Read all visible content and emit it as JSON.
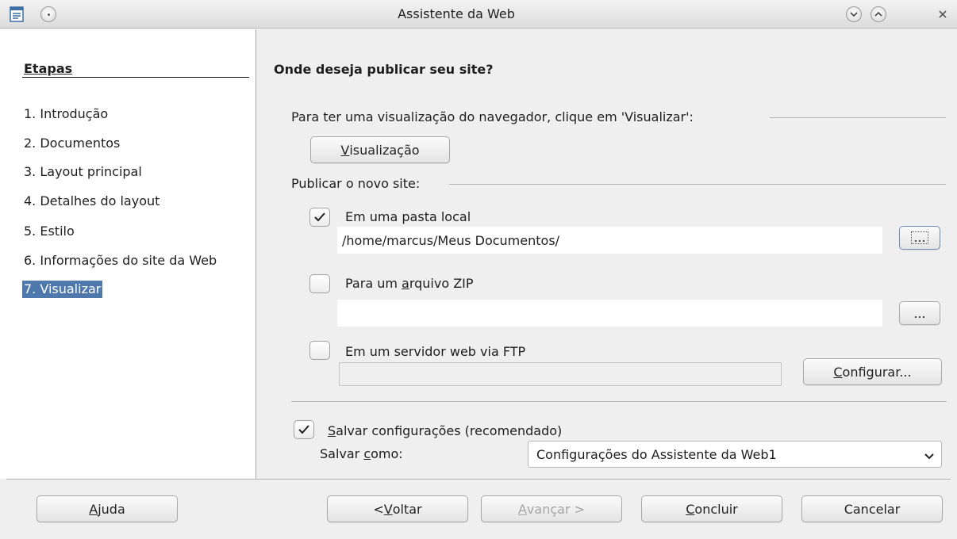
{
  "window": {
    "title": "Assistente da Web",
    "icons": [
      "document-icon",
      "menu-icon",
      "minimize-icon",
      "maximize-icon",
      "close-icon"
    ]
  },
  "steps": {
    "heading": "Etapas",
    "items": [
      {
        "label": "1. Introdução"
      },
      {
        "label": "2. Documentos"
      },
      {
        "label": "3. Layout principal"
      },
      {
        "label": "4. Detalhes do layout"
      },
      {
        "label": "5. Estilo"
      },
      {
        "label": "6. Informações do site da Web"
      },
      {
        "label": "7. Visualizar",
        "active": true
      }
    ]
  },
  "main": {
    "title": "Onde deseja publicar seu site?",
    "preview_group": {
      "label": "Para ter uma visualização do navegador, clique em 'Visualizar':",
      "button_pre": "",
      "button_mnemonic": "V",
      "button_post": "isualização"
    },
    "publish_group": {
      "label": "Publicar o novo site:",
      "local_folder": {
        "checked": true,
        "label": "Em uma pasta local",
        "path": "/home/marcus/Meus Documentos/",
        "browse_label": "..."
      },
      "zip": {
        "checked": false,
        "label_pre": "Para um ",
        "label_mnemonic": "a",
        "label_post": "rquivo ZIP",
        "path": "",
        "browse_label": "..."
      },
      "ftp": {
        "checked": false,
        "label": "Em um servidor web via FTP",
        "path": "",
        "configure_mnemonic": "C",
        "configure_post": "onfigurar..."
      }
    },
    "save_settings": {
      "checked": true,
      "label_mnemonic": "S",
      "label_post": "alvar configurações (recomendado)",
      "save_as_pre": "Salvar ",
      "save_as_mnemonic": "c",
      "save_as_post": "omo:",
      "selected": "Configurações do Assistente da Web1"
    }
  },
  "footer": {
    "help_mnemonic": "A",
    "help_post": "juda",
    "back_pre": "< ",
    "back_mnemonic": "V",
    "back_post": "oltar",
    "next_mnemonic": "A",
    "next_post": "vançar >",
    "finish_mnemonic": "C",
    "finish_post": "oncluir",
    "cancel_label": "Cancelar"
  },
  "colors": {
    "selection": "#4f78ad",
    "window_bg": "#efefef"
  }
}
